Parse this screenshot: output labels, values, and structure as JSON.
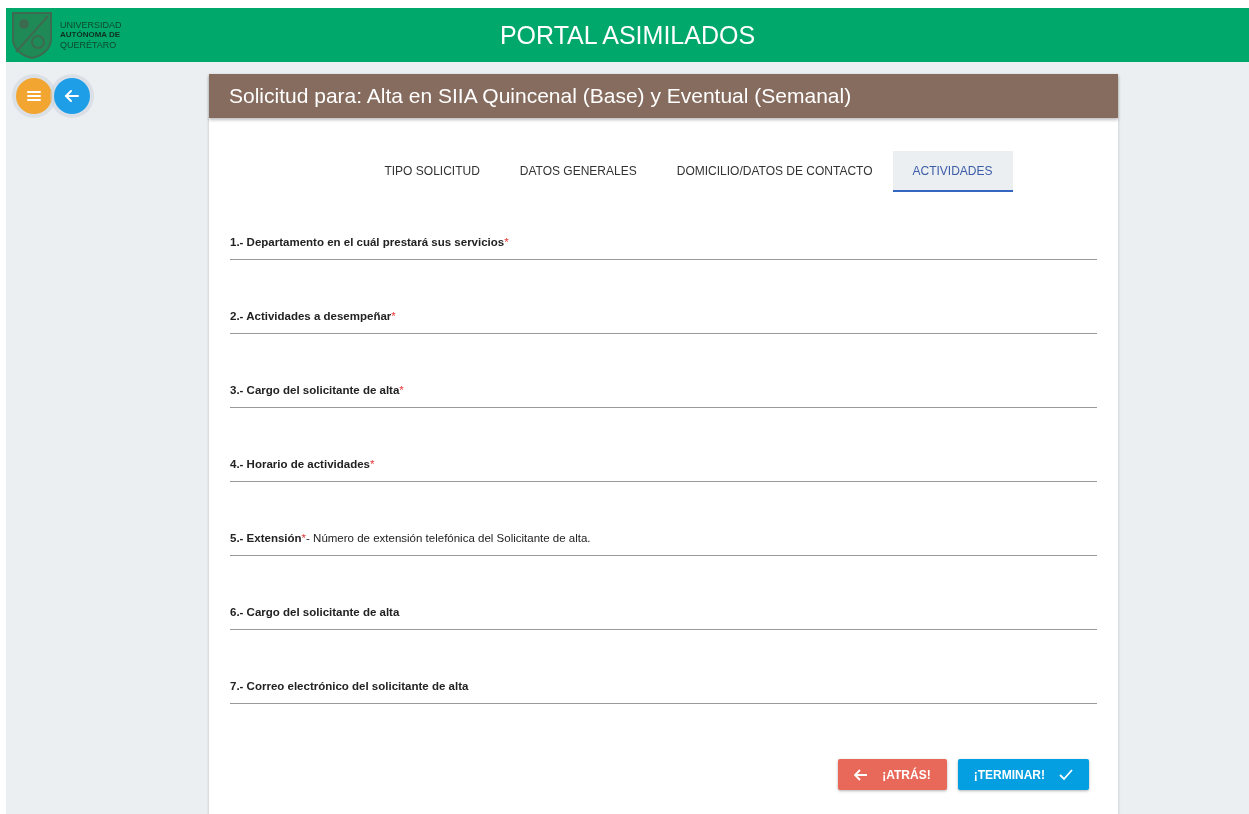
{
  "header": {
    "logo_lines": [
      "UNIVERSIDAD",
      "AUTÓNOMA DE",
      "QUERÉTARO"
    ],
    "title": "PORTAL ASIMILADOS"
  },
  "form": {
    "title": "Solicitud para: Alta en SIIA Quincenal (Base) y Eventual (Semanal)",
    "tabs": [
      {
        "label": "TIPO SOLICITUD",
        "selected": false
      },
      {
        "label": "DATOS GENERALES",
        "selected": false
      },
      {
        "label": "DOMICILIO/DATOS DE CONTACTO",
        "selected": false
      },
      {
        "label": "ACTIVIDADES",
        "selected": true
      }
    ],
    "fields": [
      {
        "label": "1.- Departamento en el cuál prestará sus servicios",
        "required_mark": "*"
      },
      {
        "label": "2.- Actividades a desempeñar",
        "required_mark": "*"
      },
      {
        "label": "3.- Cargo del solicitante de alta",
        "required_mark": "*"
      },
      {
        "label": "4.- Horario de actividades",
        "required_mark": "*"
      },
      {
        "label": "5.- Extensión",
        "required_mark": "*",
        "hint": "- Número de extensión telefónica del Solicitante de alta."
      },
      {
        "label": "6.- Cargo del solicitante de alta"
      },
      {
        "label": "7.- Correo electrónico del solicitante de alta"
      }
    ],
    "buttons": [
      {
        "label": "¡ATRÁS!",
        "kind": "back"
      },
      {
        "label": "¡TERMINAR!",
        "kind": "finish"
      }
    ]
  }
}
